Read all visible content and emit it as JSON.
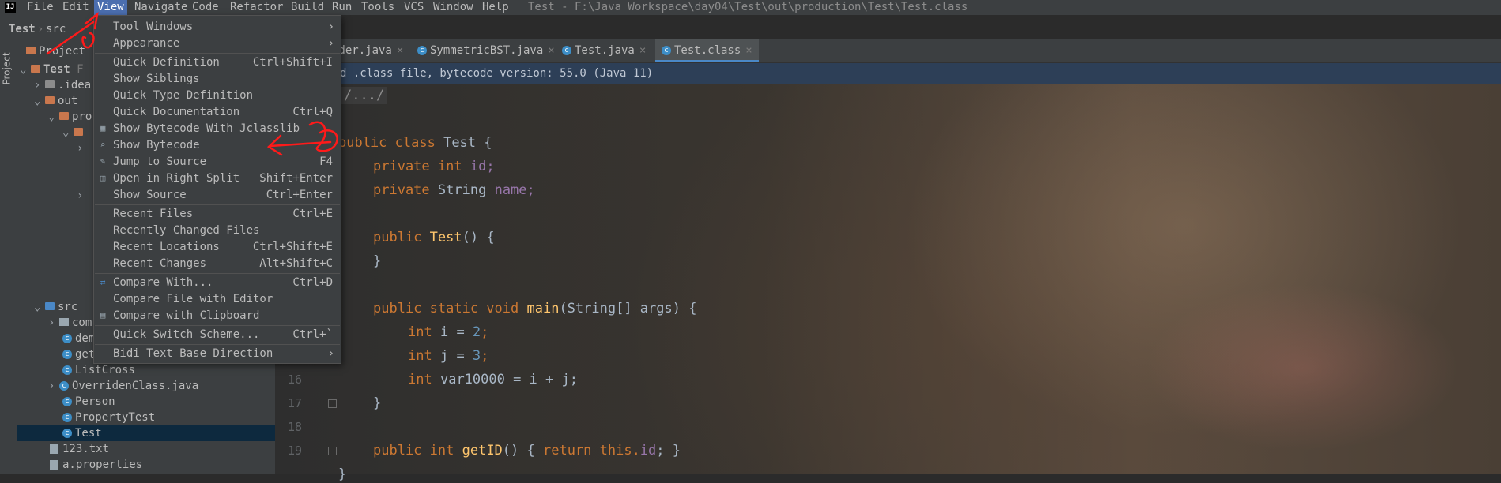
{
  "app": {
    "logo": "IJ"
  },
  "menubar": {
    "items": [
      "File",
      "Edit",
      "View",
      "Navigate",
      "Code",
      "Refactor",
      "Build",
      "Run",
      "Tools",
      "VCS",
      "Window",
      "Help"
    ],
    "title": "Test - F:\\Java_Workspace\\day04\\Test\\out\\production\\Test\\Test.class"
  },
  "breadcrumb": {
    "items": [
      "Test",
      "src"
    ]
  },
  "toolstrip": {
    "project_label": "Project"
  },
  "project": {
    "header": "Project",
    "tree": [
      {
        "label": "Test",
        "hint": "F"
      },
      {
        "label": ".idea"
      },
      {
        "label": "out"
      },
      {
        "label": "pro"
      },
      {
        "label": "src"
      },
      {
        "label": "com"
      },
      {
        "label": "dem"
      },
      {
        "label": "get"
      },
      {
        "label": "ListCross"
      },
      {
        "label": "OverridenClass.java"
      },
      {
        "label": "Person"
      },
      {
        "label": "PropertyTest"
      },
      {
        "label": "Test"
      },
      {
        "label": "123.txt"
      },
      {
        "label": "a.properties"
      }
    ]
  },
  "tabs": [
    {
      "label": "rder.java"
    },
    {
      "label": "SymmetricBST.java"
    },
    {
      "label": "Test.java"
    },
    {
      "label": "Test.class",
      "active": true
    }
  ],
  "banner": {
    "text": "d .class file, bytecode version: 55.0 (Java 11)"
  },
  "editor": {
    "line_numbers": [
      "16",
      "17",
      "18",
      "19"
    ],
    "lines": {
      "fold": "/.../",
      "class_decl_kw": "public class",
      "class_name": "Test {",
      "f1_kw": "private int",
      "f1_name": "id;",
      "f2_kw": "private",
      "f2_type": "String",
      "f2_name": "name;",
      "ctor_kw": "public",
      "ctor_name": "Test",
      "ctor_rest": "() {",
      "ctor_close": "}",
      "main_kw": "public static void",
      "main_name": "main",
      "main_rest": "(String[] args) {",
      "i_kw": "int",
      "i_rest": "i = ",
      "i_val": "2",
      "j_kw": "int",
      "j_rest": "j = ",
      "j_val": "3",
      "v_kw": "int",
      "v_rest": "var10000 = i + j;",
      "main_close": "}",
      "get_kw": "public int",
      "get_name": "getID",
      "get_rest": "() { ",
      "get_ret": "return this.",
      "get_field": "id",
      "get_end": "; }",
      "class_close": "}"
    }
  },
  "view_menu": {
    "items": [
      {
        "label": "Tool Windows",
        "submenu": true
      },
      {
        "label": "Appearance",
        "submenu": true
      },
      {
        "label": "Quick Definition",
        "shortcut": "Ctrl+Shift+I"
      },
      {
        "label": "Show Siblings"
      },
      {
        "label": "Quick Type Definition"
      },
      {
        "label": "Quick Documentation",
        "shortcut": "Ctrl+Q"
      },
      {
        "label": "Show Bytecode With Jclasslib"
      },
      {
        "label": "Show Bytecode"
      },
      {
        "label": "Jump to Source",
        "shortcut": "F4"
      },
      {
        "label": "Open in Right Split",
        "shortcut": "Shift+Enter"
      },
      {
        "label": "Show Source",
        "shortcut": "Ctrl+Enter"
      },
      {
        "label": "Recent Files",
        "shortcut": "Ctrl+E"
      },
      {
        "label": "Recently Changed Files"
      },
      {
        "label": "Recent Locations",
        "shortcut": "Ctrl+Shift+E"
      },
      {
        "label": "Recent Changes",
        "shortcut": "Alt+Shift+C"
      },
      {
        "label": "Compare With...",
        "shortcut": "Ctrl+D"
      },
      {
        "label": "Compare File with Editor"
      },
      {
        "label": "Compare with Clipboard"
      },
      {
        "label": "Quick Switch Scheme...",
        "shortcut": "Ctrl+`"
      },
      {
        "label": "Bidi Text Base Direction",
        "submenu": true
      }
    ]
  },
  "colors": {
    "menu_active": "#4b6eaf",
    "annotation": "#ff1a1a",
    "tab_underline": "#4a88c7"
  }
}
